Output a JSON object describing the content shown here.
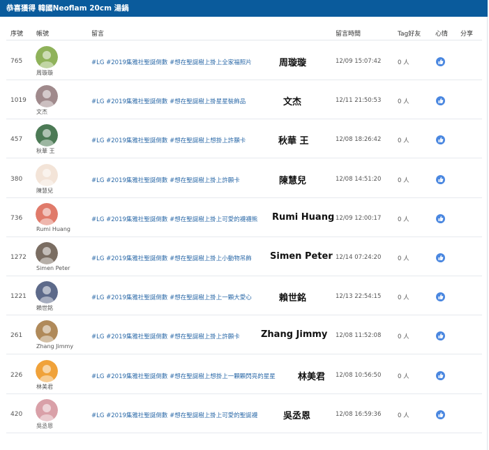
{
  "header": {
    "title": "恭喜獲得 韓國Neoflam 20cm 湯鍋"
  },
  "columns": {
    "id": "序號",
    "account": "帳號",
    "message": "留言",
    "time": "留言時間",
    "tag": "Tag好友",
    "mood": "心情",
    "share": "分享"
  },
  "rows": [
    {
      "id": "765",
      "user": "周璇璇",
      "message": "#LG #2019集雅社聖誕倒數 #想在聖誕樹上掛上全家福照片",
      "overlay": "周璇璇",
      "time": "12/09 15:07:42",
      "tag": "0 人",
      "avatar_color": "#8fb25a"
    },
    {
      "id": "1019",
      "user": "文杰",
      "message": "#LG #2019集雅社聖誕倒數 #想在聖誕樹上掛星星裝飾品",
      "overlay": "文杰",
      "time": "12/11 21:50:53",
      "tag": "0 人",
      "avatar_color": "#a08a8c"
    },
    {
      "id": "457",
      "user": "秋華 王",
      "message": "#LG #2019集雅社聖誕倒數 #想在聖誕樹上想掛上許願卡",
      "overlay": "秋華 王",
      "time": "12/08 18:26:42",
      "tag": "0 人",
      "avatar_color": "#4c7a55"
    },
    {
      "id": "380",
      "user": "陳慧兒",
      "message": "#LG #2019集雅社聖誕倒數 #想在聖誕樹上掛上許願卡",
      "overlay": "陳慧兒",
      "time": "12/08 14:51:20",
      "tag": "0 人",
      "avatar_color": "#f3e4d8"
    },
    {
      "id": "736",
      "user": "Rumi Huang",
      "message": "#LG #2019集雅社聖誕倒數 #想在聖誕樹上掛上可愛的襪襪熊",
      "overlay": "Rumi Huang",
      "time": "12/09 12:00:17",
      "tag": "0 人",
      "avatar_color": "#e07a6a"
    },
    {
      "id": "1272",
      "user": "Simen Peter",
      "message": "#LG #2019集雅社聖誕倒數 #想在聖誕樹上掛上小動物吊飾",
      "overlay": "Simen Peter",
      "time": "12/14 07:24:20",
      "tag": "0 人",
      "avatar_color": "#7a6d62"
    },
    {
      "id": "1221",
      "user": "賴世銘",
      "message": "#LG #2019集雅社聖誕倒數 #想在聖誕樹上掛上一顆大愛心",
      "overlay": "賴世銘",
      "time": "12/13 22:54:15",
      "tag": "0 人",
      "avatar_color": "#5d6a8a"
    },
    {
      "id": "261",
      "user": "Zhang Jimmy",
      "message": "#LG #2019集雅社聖誕倒數 #想在聖誕樹上掛上許願卡",
      "overlay": "Zhang Jimmy",
      "time": "12/08 11:52:08",
      "tag": "0 人",
      "avatar_color": "#b08a5a"
    },
    {
      "id": "226",
      "user": "林美君",
      "message": "#LG #2019集雅社聖誕倒數 #想在聖誕樹上想掛上一顆顆閃亮的星星",
      "overlay": "林美君",
      "time": "12/08 10:56:50",
      "tag": "0 人",
      "avatar_color": "#f0a23a"
    },
    {
      "id": "420",
      "user": "吳丞恩",
      "message": "#LG #2019集雅社聖誕倒數 #想在聖誕樹上掛上可愛的聖誕襪",
      "overlay": "吳丞恩",
      "time": "12/08 16:59:36",
      "tag": "0 人",
      "avatar_color": "#d9a0a8"
    }
  ]
}
